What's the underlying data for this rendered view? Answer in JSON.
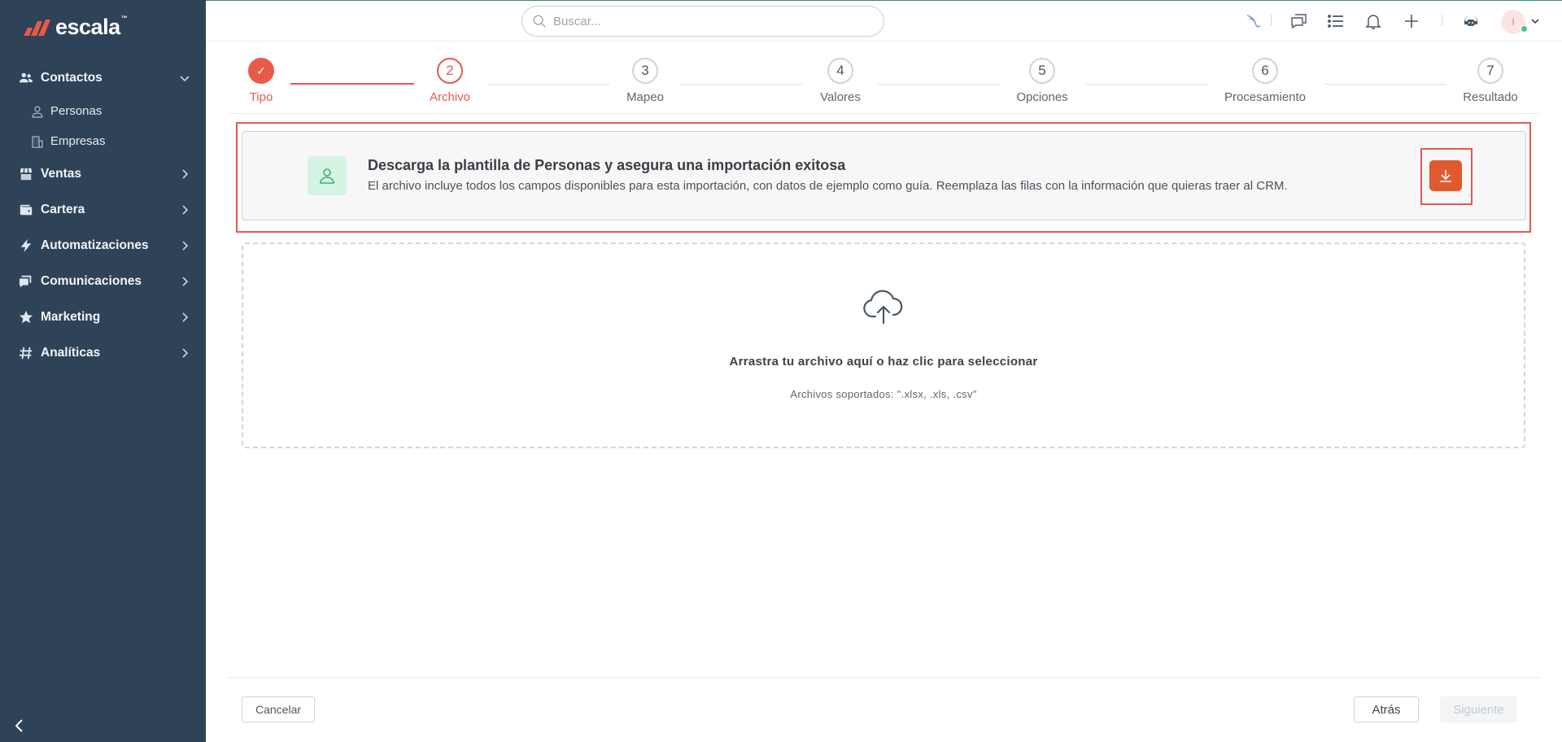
{
  "brand": {
    "name": "escala",
    "tm": "™",
    "accent": "#e8594a"
  },
  "sidebar": {
    "items": [
      {
        "label": "Contactos",
        "icon": "users-icon",
        "expanded": true
      },
      {
        "label": "Ventas",
        "icon": "store-icon"
      },
      {
        "label": "Cartera",
        "icon": "wallet-icon"
      },
      {
        "label": "Automatizaciones",
        "icon": "bolt-icon"
      },
      {
        "label": "Comunicaciones",
        "icon": "chat-icon"
      },
      {
        "label": "Marketing",
        "icon": "star-icon"
      },
      {
        "label": "Analíticas",
        "icon": "hash-icon"
      }
    ],
    "subitems": [
      {
        "label": "Personas",
        "icon": "person-icon"
      },
      {
        "label": "Empresas",
        "icon": "building-icon"
      }
    ]
  },
  "topbar": {
    "search_placeholder": "Buscar...",
    "avatar_initial": "I"
  },
  "stepper": {
    "steps": [
      {
        "num": "✓",
        "label": "Tipo",
        "state": "done"
      },
      {
        "num": "2",
        "label": "Archivo",
        "state": "active"
      },
      {
        "num": "3",
        "label": "Mapeo",
        "state": "pending"
      },
      {
        "num": "4",
        "label": "Valores",
        "state": "pending"
      },
      {
        "num": "5",
        "label": "Opciones",
        "state": "pending"
      },
      {
        "num": "6",
        "label": "Procesamiento",
        "state": "pending"
      },
      {
        "num": "7",
        "label": "Resultado",
        "state": "pending"
      }
    ]
  },
  "banner": {
    "title": "Descarga la plantilla de Personas y asegura una importación exitosa",
    "description": "El archivo incluye todos los campos disponibles para esta importación, con datos de ejemplo como guía. Reemplaza las filas con la información que quieras traer al CRM."
  },
  "dropzone": {
    "title": "Arrastra tu archivo aquí o haz clic para seleccionar",
    "subtitle": "Archivos soportados: \".xlsx, .xls, .csv\""
  },
  "footer": {
    "cancel": "Cancelar",
    "back": "Atrás",
    "next": "Siguiente"
  }
}
